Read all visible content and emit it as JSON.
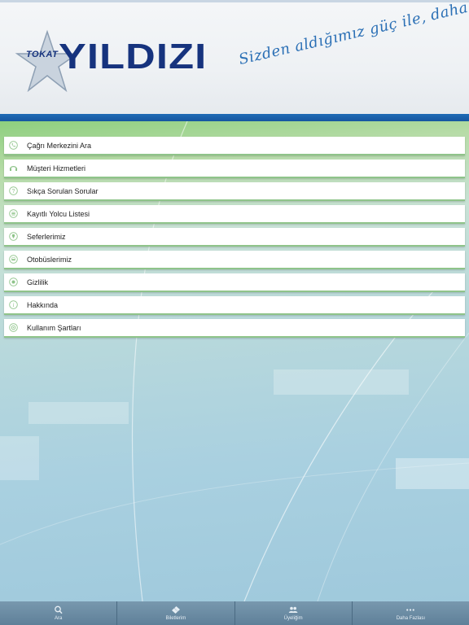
{
  "header": {
    "logo_small": "TOKAT",
    "logo_big": "YILDIZI",
    "slogan": "Sizden aldığımız güç ile, daha ileriye...",
    "logo_star_color": "#b8c8dc",
    "brand_color": "#16337e",
    "bar_color": "#1f6bb5"
  },
  "menu": {
    "items": [
      {
        "label": "Çağrı Merkezini Ara",
        "icon": "phone-icon"
      },
      {
        "label": "Müşteri Hizmetleri",
        "icon": "headset-icon"
      },
      {
        "label": "Sıkça Sorulan Sorular",
        "icon": "question-icon"
      },
      {
        "label": "Kayıtlı Yolcu Listesi",
        "icon": "list-icon"
      },
      {
        "label": "Seferlerimiz",
        "icon": "location-pin-icon"
      },
      {
        "label": "Otobüslerimiz",
        "icon": "bus-icon"
      },
      {
        "label": "Gizlilik",
        "icon": "privacy-icon"
      },
      {
        "label": "Hakkında",
        "icon": "info-icon"
      },
      {
        "label": "Kullanım Şartları",
        "icon": "terms-icon"
      }
    ],
    "accent_color": "#8fc48a"
  },
  "tabbar": {
    "tabs": [
      {
        "label": "Ara",
        "icon": "search-icon"
      },
      {
        "label": "Biletlerim",
        "icon": "ticket-icon"
      },
      {
        "label": "Üyeliğim",
        "icon": "users-icon"
      },
      {
        "label": "Daha Fazlası",
        "icon": "more-icon"
      }
    ]
  }
}
